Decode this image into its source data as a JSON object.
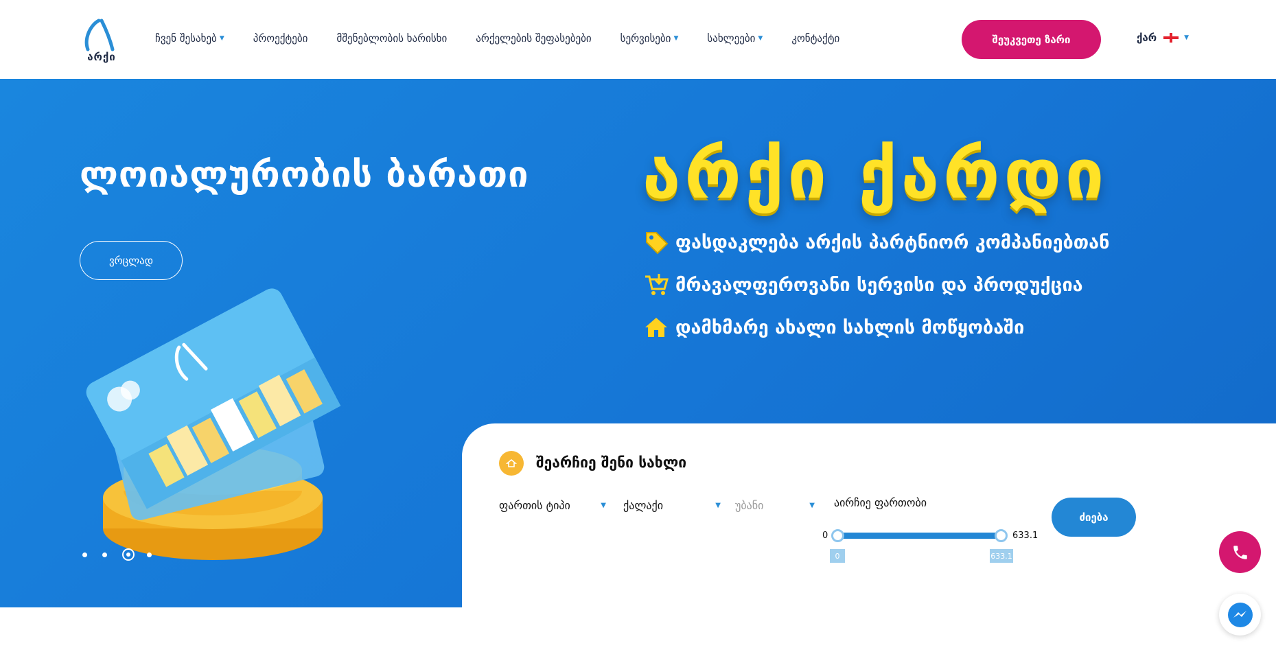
{
  "header": {
    "logo_text": "არქი",
    "nav": [
      {
        "label": "ჩვენ შესახებ",
        "dropdown": true
      },
      {
        "label": "პროექტები",
        "dropdown": false
      },
      {
        "label": "მშენებლობის ხარისხი",
        "dropdown": false
      },
      {
        "label": "არქელების შეფასებები",
        "dropdown": false
      },
      {
        "label": "სერვისები",
        "dropdown": true
      },
      {
        "label": "სახლეები",
        "dropdown": true
      },
      {
        "label": "კონტაქტი",
        "dropdown": false
      }
    ],
    "cta_label": "შეუკვეთე ზარი",
    "language": "ქარ"
  },
  "hero": {
    "title": "ლოიალურობის ბარათი",
    "button_label": "ვრცლად",
    "brand_title": "არქი ქარდი",
    "features": [
      {
        "text": "ფასდაკლება არქის პარტნიორ კომპანიებთან",
        "icon": "tag-icon"
      },
      {
        "text": "მრავალფეროვანი სერვისი და პროდუქცია",
        "icon": "cart-icon"
      },
      {
        "text": "დამხმარე ახალი სახლის მოწყობაში",
        "icon": "home-icon"
      }
    ],
    "slides": {
      "count": 4,
      "active": 3
    }
  },
  "search": {
    "title": "შეარჩიე შენი სახლი",
    "fields": [
      {
        "label": "ფართის ტიპი",
        "muted": false
      },
      {
        "label": "ქალაქი",
        "muted": false
      },
      {
        "label": "უბანი",
        "muted": true
      }
    ],
    "range_label": "აირჩიე ფართობი",
    "range": {
      "min": "0",
      "max": "633.1",
      "selected_min": "0",
      "selected_max": "633.1"
    },
    "button_label": "ძიება"
  },
  "colors": {
    "primary_blue": "#2387d5",
    "accent_pink": "#d4176f",
    "brand_yellow": "#ffe227",
    "icon_orange": "#f7b733"
  }
}
